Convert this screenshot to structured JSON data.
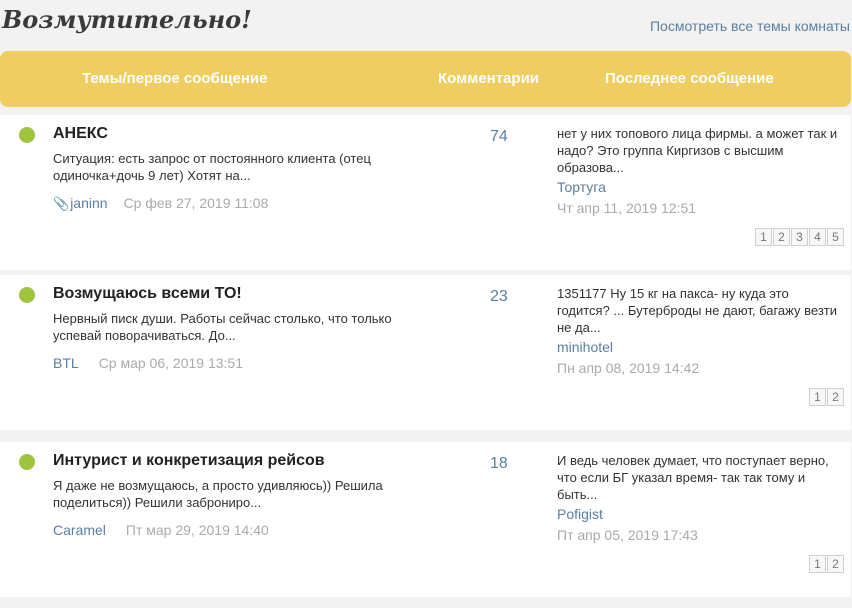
{
  "header": {
    "title": "Возмутительно!",
    "all_topics_link": "Посмотреть все темы комнаты"
  },
  "table": {
    "columns": {
      "topic": "Темы/первое сообщение",
      "comments": "Комментарии",
      "last_message": "Последнее сообщение"
    }
  },
  "topics": [
    {
      "title": "АНЕКС",
      "excerpt": "Ситуация: есть запрос от постоянного клиента (отец одиночка+дочь 9 лет) Хотят на...",
      "attachment_icon": "paperclip-icon",
      "author": "janinn",
      "date": "Ср фев 27, 2019 11:08",
      "comments": "74",
      "last": {
        "text": "нет у них топового лица фирмы. а может так и надо? Это группа Киргизов с высшим образова...",
        "author": "Тортуга",
        "date": "Чт апр 11, 2019 12:51"
      },
      "pages": [
        "1",
        "2",
        "3",
        "4",
        "5"
      ]
    },
    {
      "title": "Возмущаюсь всеми ТО!",
      "excerpt": "Нервный писк души. Работы сейчас столько, что только успевай поворачиваться. До...",
      "author": "BTL",
      "date": "Ср мар 06, 2019 13:51",
      "comments": "23",
      "last": {
        "text": "1351177 Ну 15 кг на пакса- ну куда это годится? ... Бутерброды не дают, багажу везти не да...",
        "author": "minihotel",
        "date": "Пн апр 08, 2019 14:42"
      },
      "pages": [
        "1",
        "2"
      ]
    },
    {
      "title": "Интурист и конкретизация рейсов",
      "excerpt": "Я даже не возмущаюсь, а просто удивляюсь)) Решила поделиться)) Решили заброниро...",
      "author": "Caramel",
      "date": "Пт мар 29, 2019 14:40",
      "comments": "18",
      "last": {
        "text": "И ведь человек думает, что поступает верно, что если БГ указал время- так так тому и быть...",
        "author": "Pofigist",
        "date": "Пт апр 05, 2019 17:43"
      },
      "pages": [
        "1",
        "2"
      ]
    }
  ],
  "colors": {
    "header_bar": "#efcd61",
    "status_dot": "#9ec440",
    "link": "#5a7fa0"
  }
}
